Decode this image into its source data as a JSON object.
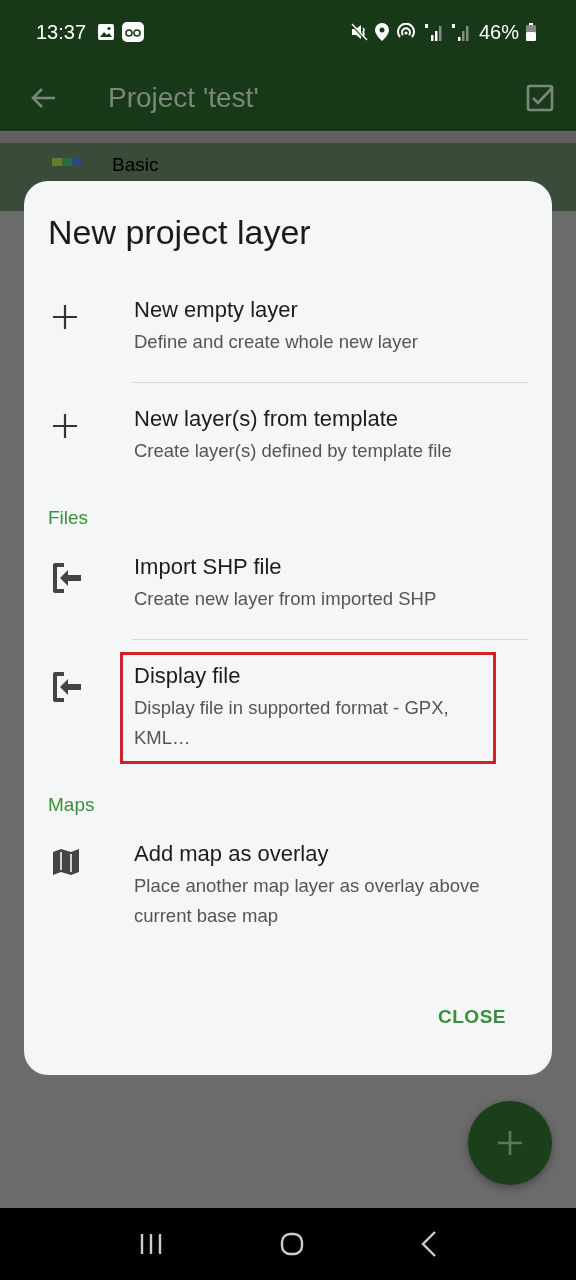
{
  "status_bar": {
    "time": "13:37",
    "battery": "46%"
  },
  "app_bar": {
    "title": "Project 'test'"
  },
  "background_list": [
    {
      "title": "Basic"
    }
  ],
  "dialog": {
    "title": "New project layer",
    "sections": [
      {
        "items": [
          {
            "kind": "add",
            "title": "New empty layer",
            "subtitle": "Define and create whole new layer",
            "highlighted": false
          },
          {
            "kind": "add",
            "title": "New layer(s) from template",
            "subtitle": "Create layer(s) defined by template file",
            "highlighted": false
          }
        ]
      },
      {
        "header": "Files",
        "items": [
          {
            "kind": "import",
            "title": "Import SHP file",
            "subtitle": "Create new layer from imported SHP",
            "highlighted": false
          },
          {
            "kind": "import",
            "title": "Display file",
            "subtitle": "Display file in supported format - GPX, KML…",
            "highlighted": true
          }
        ]
      },
      {
        "header": "Maps",
        "items": [
          {
            "kind": "map",
            "title": "Add map as overlay",
            "subtitle": "Place another map layer as overlay above current base map",
            "highlighted": false
          }
        ]
      }
    ],
    "close_button": "CLOSE"
  }
}
